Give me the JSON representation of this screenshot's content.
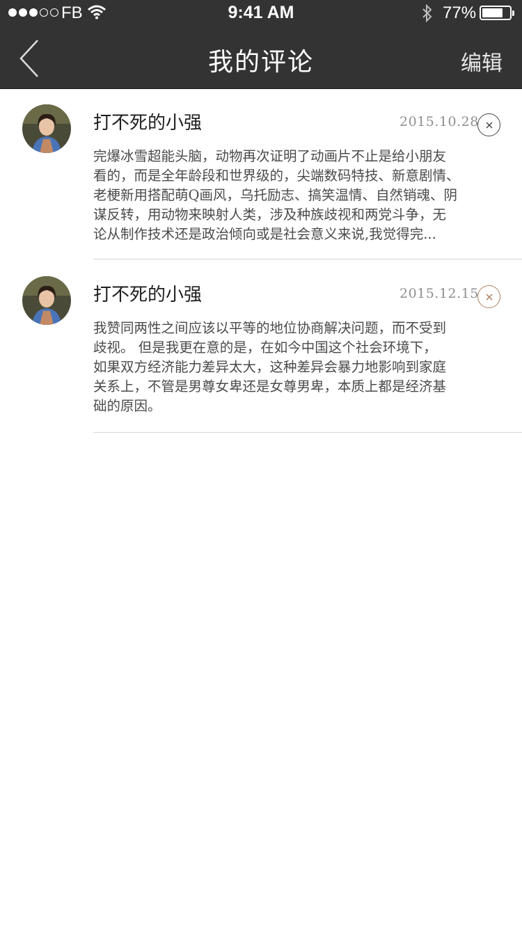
{
  "status_bar": {
    "carrier": "FB",
    "time": "9:41 AM",
    "battery": "77%",
    "battery_level": 0.77,
    "signal_bars_filled": 3,
    "signal_bars_total": 5
  },
  "nav": {
    "title": "我的评论",
    "edit_label": "编辑",
    "back_icon": "chevron-left-icon"
  },
  "comments": [
    {
      "username": "打不死的小强",
      "date": "2015.10.28",
      "delete_icon": "close-circle-icon",
      "lines": [
        "完爆冰雪超能头脑，动物再次证明了动画片不止是给小朋友",
        "看的，而是全年龄段和世界级的，尖端数码特技、新意剧情、",
        "老梗新用搭配萌Q画风，乌托励志、搞笑温情、自然销魂、阴",
        "谋反转，用动物来映射人类，涉及种族歧视和两党斗争，无",
        "论从制作技术还是政治倾向或是社会意义来说,我觉得完..."
      ]
    },
    {
      "username": "打不死的小强",
      "date": "2015.12.15",
      "delete_icon": "close-circle-icon",
      "lines": [
        "我赞同两性之间应该以平等的地位协商解决问题，而不受到",
        "歧视。 但是我更在意的是，在如今中国这个社会环境下，",
        "如果双方经济能力差异太大，这种差异会暴力地影响到家庭",
        "关系上，不管是男尊女卑还是女尊男卑，本质上都是经济基",
        "础的原因。"
      ]
    }
  ],
  "colors": {
    "nav_background": "#333333",
    "delete_accent": "#b08060"
  }
}
